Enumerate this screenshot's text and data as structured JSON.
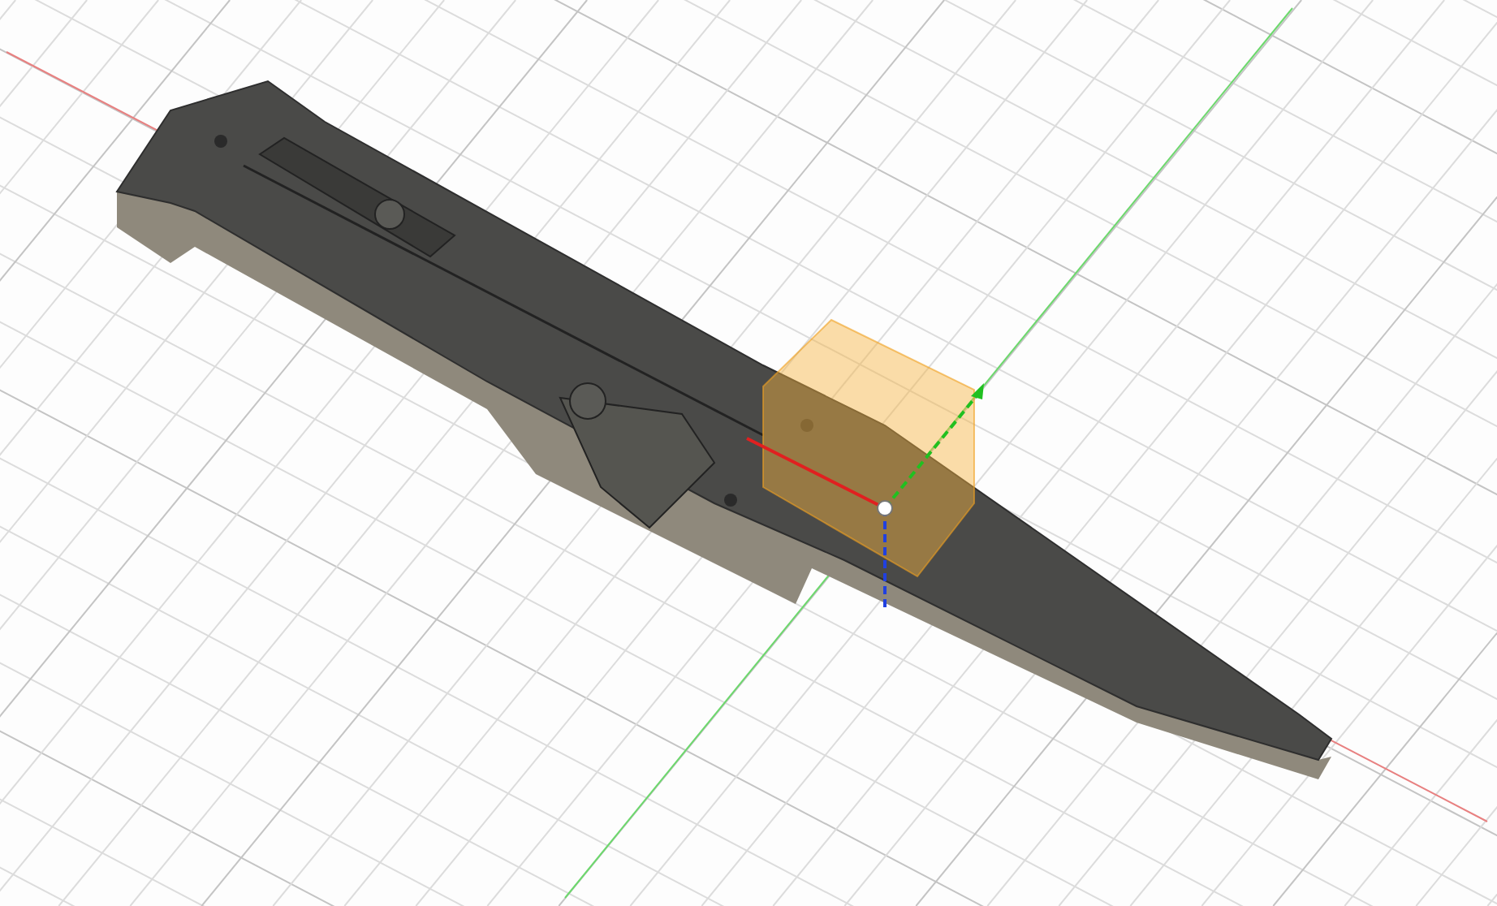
{
  "viewport": {
    "show_grid": true,
    "show_axes": true,
    "show_gizmo": true
  }
}
